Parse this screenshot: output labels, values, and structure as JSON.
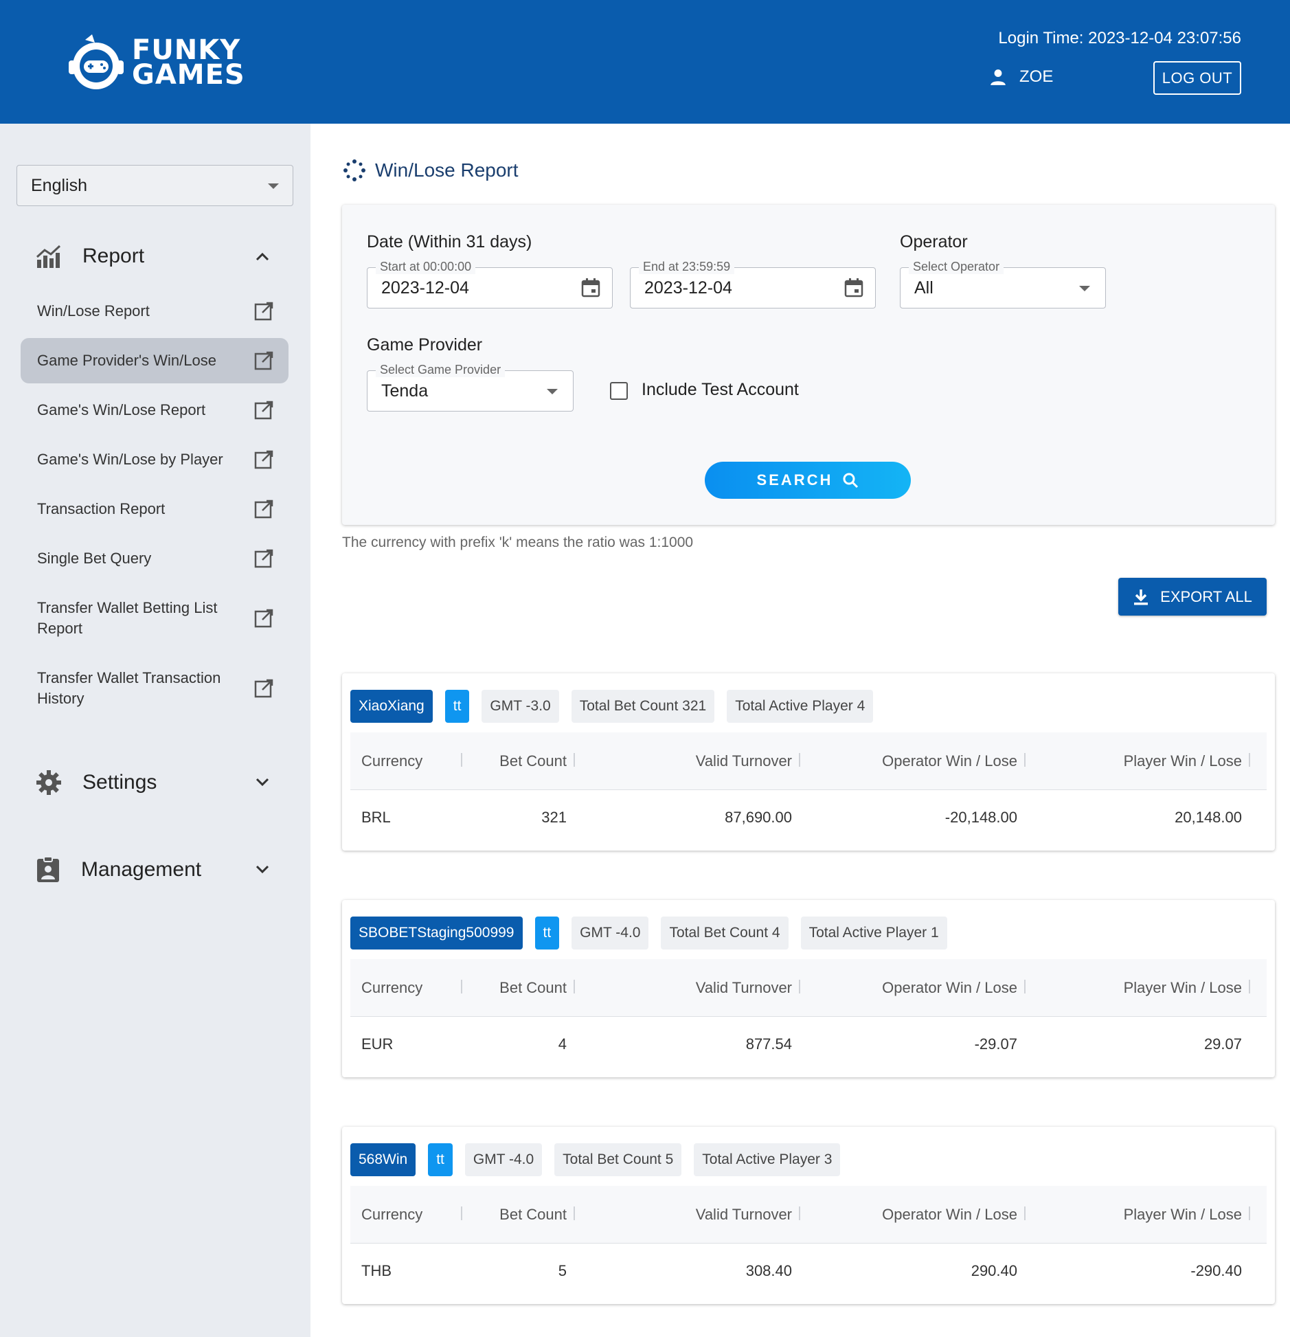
{
  "header": {
    "brand_line1": "FUNKY",
    "brand_line2": "GAMES",
    "login_time": "Login Time: 2023-12-04 23:07:56",
    "username": "ZOE",
    "logout_label": "LOG OUT"
  },
  "sidebar": {
    "language": "English",
    "report_section": "Report",
    "items": [
      {
        "label": "Win/Lose Report"
      },
      {
        "label": "Game Provider's Win/Lose"
      },
      {
        "label": "Game's Win/Lose Report"
      },
      {
        "label": "Game's Win/Lose by Player"
      },
      {
        "label": "Transaction Report"
      },
      {
        "label": "Single Bet Query"
      },
      {
        "label": "Transfer Wallet Betting List Report"
      },
      {
        "label": "Transfer Wallet Transaction History"
      }
    ],
    "settings_section": "Settings",
    "management_section": "Management"
  },
  "main": {
    "title": "Win/Lose Report",
    "filters": {
      "date_label": "Date (Within 31 days)",
      "start_legend": "Start at 00:00:00",
      "start_value": "2023-12-04",
      "end_legend": "End at 23:59:59",
      "end_value": "2023-12-04",
      "operator_label": "Operator",
      "operator_legend": "Select Operator",
      "operator_value": "All",
      "provider_label": "Game Provider",
      "provider_legend": "Select Game Provider",
      "provider_value": "Tenda",
      "include_test_label": "Include Test Account",
      "search_label": "SEARCH"
    },
    "note": "The currency with prefix 'k' means the ratio was 1:1000",
    "export_label": "EXPORT ALL",
    "columns": [
      "Currency",
      "Bet Count",
      "Valid Turnover",
      "Operator Win / Lose",
      "Player Win / Lose"
    ],
    "operators": [
      {
        "name": "XiaoXiang",
        "tag": "tt",
        "gmt": "GMT -3.0",
        "total_bet": "Total Bet Count 321",
        "total_player": "Total Active Player 4",
        "row": [
          "BRL",
          "321",
          "87,690.00",
          "-20,148.00",
          "20,148.00"
        ]
      },
      {
        "name": "SBOBETStaging500999",
        "tag": "tt",
        "gmt": "GMT -4.0",
        "total_bet": "Total Bet Count 4",
        "total_player": "Total Active Player 1",
        "row": [
          "EUR",
          "4",
          "877.54",
          "-29.07",
          "29.07"
        ]
      },
      {
        "name": "568Win",
        "tag": "tt",
        "gmt": "GMT -4.0",
        "total_bet": "Total Bet Count 5",
        "total_player": "Total Active Player 3",
        "row": [
          "THB",
          "5",
          "308.40",
          "290.40",
          "-290.40"
        ]
      }
    ]
  }
}
